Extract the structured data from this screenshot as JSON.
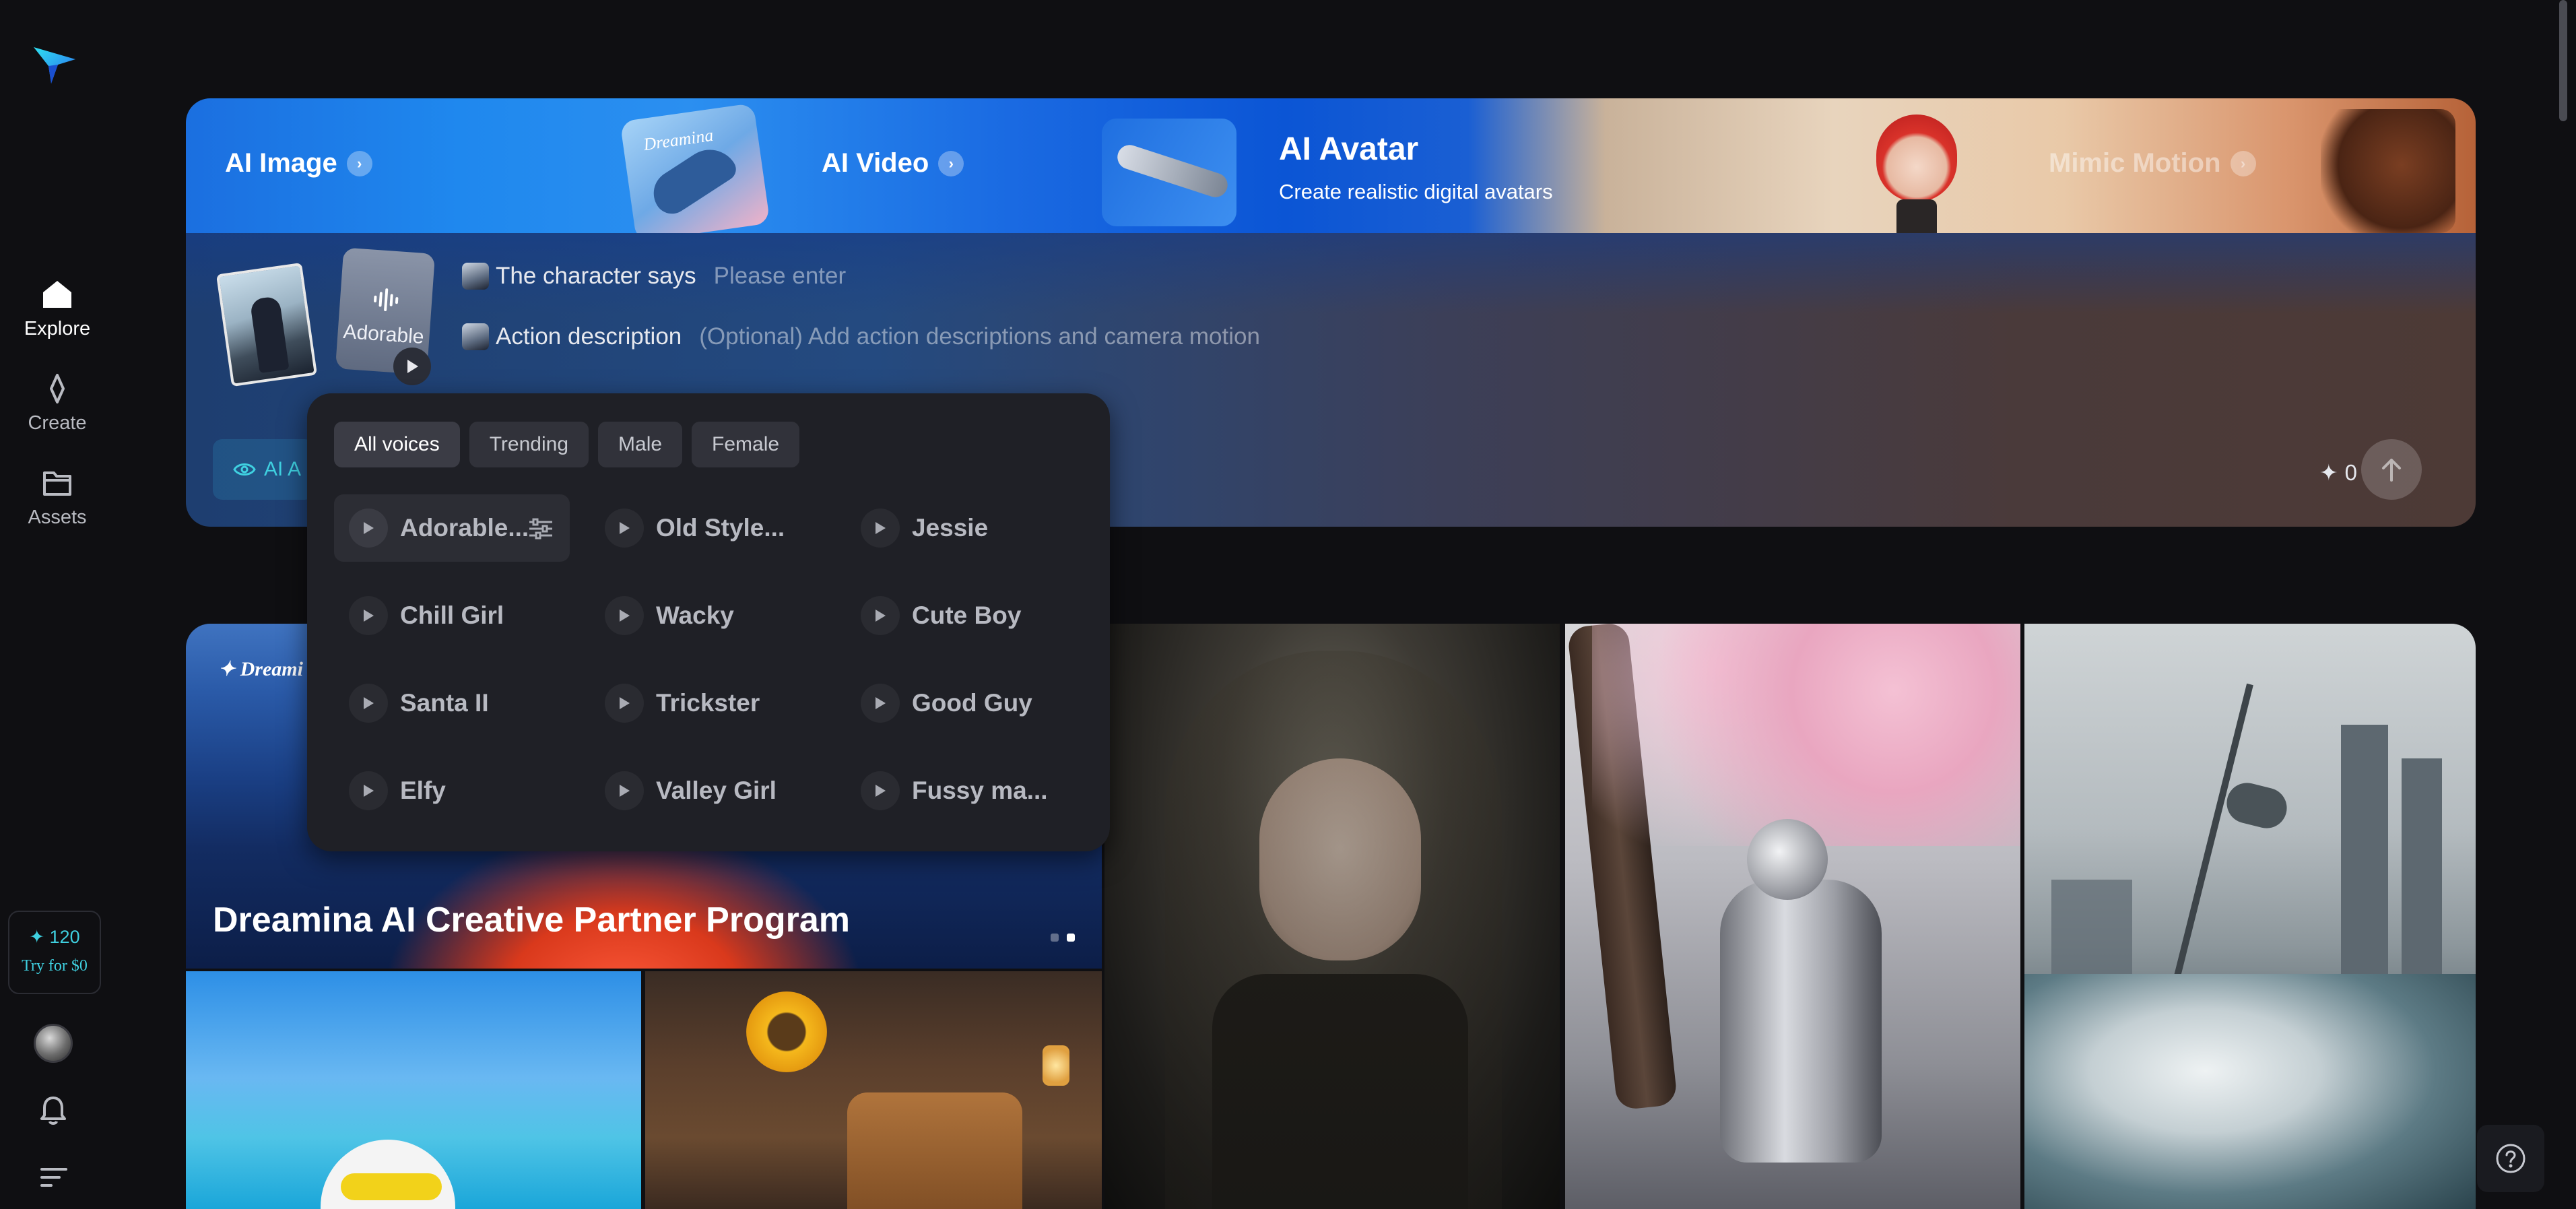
{
  "sidebar": {
    "nav": [
      {
        "label": "Explore",
        "icon": "home-icon",
        "active": true
      },
      {
        "label": "Create",
        "icon": "sparkle-diamond-icon",
        "active": false
      },
      {
        "label": "Assets",
        "icon": "folder-icon",
        "active": false
      }
    ],
    "credits": {
      "count": "120",
      "try_label": "Try for $0"
    }
  },
  "banner": {
    "tabs": [
      {
        "label": "AI Image"
      },
      {
        "label": "AI Video"
      },
      {
        "label": "AI Avatar",
        "subtitle": "Create realistic digital avatars",
        "active": true
      },
      {
        "label": "Mimic Motion"
      }
    ],
    "card_text": "Dreamina"
  },
  "generator": {
    "voice_card_label": "Adorable",
    "character_label": "The character says",
    "character_placeholder": "Please enter",
    "action_label": "Action description",
    "action_placeholder": "(Optional) Add action descriptions and camera motion",
    "ai_button_label": "AI A",
    "credit_cost": "0"
  },
  "voice_picker": {
    "filters": [
      {
        "label": "All voices",
        "active": true
      },
      {
        "label": "Trending",
        "active": false
      },
      {
        "label": "Male",
        "active": false
      },
      {
        "label": "Female",
        "active": false
      }
    ],
    "voices": [
      {
        "label": "Adorable...",
        "selected": true
      },
      {
        "label": "Old Style...",
        "selected": false
      },
      {
        "label": "Jessie",
        "selected": false
      },
      {
        "label": "Chill Girl",
        "selected": false
      },
      {
        "label": "Wacky",
        "selected": false
      },
      {
        "label": "Cute Boy",
        "selected": false
      },
      {
        "label": "Santa II",
        "selected": false
      },
      {
        "label": "Trickster",
        "selected": false
      },
      {
        "label": "Good Guy",
        "selected": false
      },
      {
        "label": "Elfy",
        "selected": false
      },
      {
        "label": "Valley Girl",
        "selected": false
      },
      {
        "label": "Fussy ma...",
        "selected": false
      }
    ]
  },
  "gallery": {
    "promo_brand": "Dreami",
    "promo_title": "Dreamina AI Creative Partner Program",
    "carousel_active_index": 1,
    "carousel_count": 2
  },
  "colors": {
    "accent": "#3fd0e0",
    "background": "#0f0f12",
    "popover": "#1f2026"
  }
}
